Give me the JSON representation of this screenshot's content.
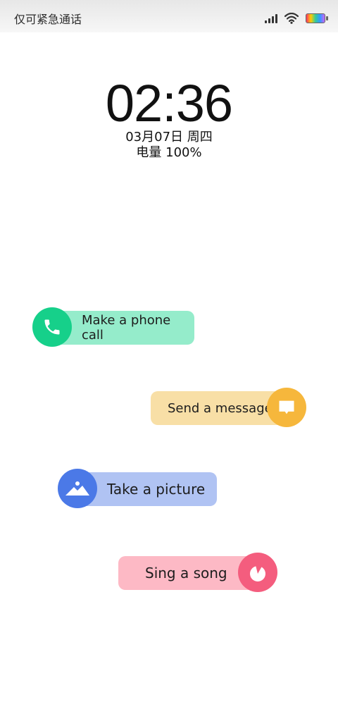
{
  "status_bar": {
    "carrier_text": "仅可紧急通话",
    "icons": [
      "signal-icon",
      "wifi-icon",
      "battery-icon"
    ]
  },
  "lock_screen": {
    "time": "02:36",
    "date": "03月07日 周四",
    "battery": "电量 100%"
  },
  "actions": [
    {
      "label": "Make a phone call",
      "icon": "phone-icon",
      "color": "#16d08a",
      "pill_color": "#95eccb"
    },
    {
      "label": "Send a message",
      "icon": "message-icon",
      "color": "#f6b73c",
      "pill_color": "#f8dfa6"
    },
    {
      "label": "Take a picture",
      "icon": "image-icon",
      "color": "#4b79e7",
      "pill_color": "#b0c3f3"
    },
    {
      "label": "Sing a song",
      "icon": "music-icon",
      "color": "#f45d7e",
      "pill_color": "#fdb9c5"
    }
  ]
}
